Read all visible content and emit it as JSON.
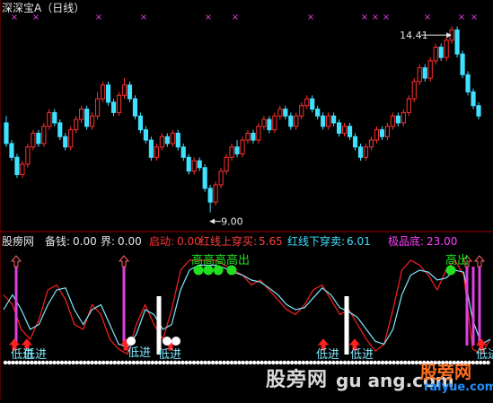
{
  "top_panel": {
    "title": "深深宝A（日线）",
    "high_label": "14.41",
    "low_label": "9.00"
  },
  "bottom_panel": {
    "name": "股痨网",
    "fields": [
      {
        "label": "备钱:",
        "value": "0.00",
        "color": "#e6e6e6"
      },
      {
        "label": "界:",
        "value": "0.00",
        "color": "#e6e6e6"
      },
      {
        "label": "启动:",
        "value": "0.00",
        "color": "#ff3030"
      },
      {
        "label": "红线上穿买:",
        "value": "5.65",
        "color": "#ff4040"
      },
      {
        "label": "红线下穿卖:",
        "value": "6.01",
        "color": "#40e0ff"
      },
      {
        "label": "极品底:",
        "value": "23.00",
        "color": "#ff40ff"
      }
    ],
    "signal_texts": {
      "high_out": "高出",
      "low_in": "低进",
      "high_out_stacked": "高高高高出"
    }
  },
  "watermarks": {
    "main": "股旁网",
    "url": "gu   ang.com",
    "logo_text": "股旁网",
    "logo_url": "ralyue.com"
  },
  "colors": {
    "up": "#ff3030",
    "down": "#40e0ff",
    "white_line": "#ffffff",
    "red_line": "#ff2020",
    "cyan_line": "#80e8ff",
    "magenta": "#e040e0",
    "green": "#20e020",
    "divider": "#a00000"
  },
  "chart_data": [
    {
      "type": "candlestick",
      "title": "深深宝A（日线）",
      "annotations": [
        {
          "text": "14.41",
          "meaning": "period high"
        },
        {
          "text": "9.00",
          "meaning": "period low"
        }
      ],
      "ylim": [
        8.6,
        14.7
      ],
      "candles": [
        [
          11.6,
          11.0,
          11.8,
          10.9
        ],
        [
          11.0,
          10.6,
          11.1,
          10.5
        ],
        [
          10.6,
          10.1,
          10.7,
          10.0
        ],
        [
          10.1,
          10.4,
          10.5,
          10.0
        ],
        [
          10.4,
          10.9,
          11.0,
          10.3
        ],
        [
          10.9,
          11.3,
          11.4,
          10.8
        ],
        [
          11.3,
          11.0,
          11.4,
          10.9
        ],
        [
          11.0,
          11.5,
          11.6,
          10.9
        ],
        [
          11.5,
          11.9,
          12.0,
          11.4
        ],
        [
          11.9,
          11.6,
          12.0,
          11.5
        ],
        [
          11.6,
          11.2,
          11.7,
          11.1
        ],
        [
          11.2,
          10.9,
          11.3,
          10.8
        ],
        [
          10.9,
          11.4,
          11.5,
          10.8
        ],
        [
          11.4,
          11.7,
          11.8,
          11.3
        ],
        [
          11.7,
          12.0,
          12.1,
          11.6
        ],
        [
          12.0,
          11.5,
          12.1,
          11.4
        ],
        [
          11.5,
          11.8,
          11.9,
          11.4
        ],
        [
          11.8,
          12.3,
          12.5,
          11.7
        ],
        [
          12.3,
          12.7,
          12.8,
          12.2
        ],
        [
          12.7,
          12.2,
          12.8,
          12.1
        ],
        [
          12.2,
          11.9,
          12.3,
          11.8
        ],
        [
          11.9,
          12.4,
          12.5,
          11.8
        ],
        [
          12.4,
          12.7,
          12.9,
          12.3
        ],
        [
          12.7,
          12.3,
          12.8,
          12.2
        ],
        [
          12.3,
          11.8,
          12.4,
          11.7
        ],
        [
          11.8,
          11.4,
          11.9,
          11.3
        ],
        [
          11.4,
          11.1,
          11.5,
          11.0
        ],
        [
          11.1,
          10.6,
          11.2,
          10.5
        ],
        [
          10.6,
          10.9,
          11.0,
          10.5
        ],
        [
          10.9,
          11.2,
          11.3,
          10.8
        ],
        [
          11.2,
          11.0,
          11.3,
          10.9
        ],
        [
          11.0,
          11.3,
          11.4,
          10.9
        ],
        [
          11.3,
          10.9,
          11.4,
          10.8
        ],
        [
          10.9,
          10.6,
          11.0,
          10.5
        ],
        [
          10.6,
          10.2,
          10.7,
          10.1
        ],
        [
          10.2,
          10.5,
          10.6,
          10.1
        ],
        [
          10.5,
          10.3,
          10.6,
          10.2
        ],
        [
          10.3,
          9.7,
          10.4,
          9.6
        ],
        [
          9.7,
          9.3,
          9.8,
          9.0
        ],
        [
          9.3,
          9.8,
          9.9,
          9.2
        ],
        [
          9.8,
          10.2,
          10.3,
          9.7
        ],
        [
          10.2,
          10.6,
          10.7,
          10.1
        ],
        [
          10.6,
          10.9,
          11.0,
          10.5
        ],
        [
          10.9,
          10.7,
          11.1,
          10.6
        ],
        [
          10.7,
          11.1,
          11.2,
          10.6
        ],
        [
          11.1,
          11.3,
          11.4,
          11.0
        ],
        [
          11.3,
          11.1,
          11.4,
          11.0
        ],
        [
          11.1,
          11.5,
          11.6,
          11.0
        ],
        [
          11.5,
          11.7,
          11.8,
          11.4
        ],
        [
          11.7,
          11.4,
          11.8,
          11.3
        ],
        [
          11.4,
          11.8,
          11.9,
          11.3
        ],
        [
          11.8,
          12.0,
          12.1,
          11.7
        ],
        [
          12.0,
          11.8,
          12.1,
          11.7
        ],
        [
          11.8,
          11.5,
          11.9,
          11.4
        ],
        [
          11.5,
          11.8,
          11.9,
          11.4
        ],
        [
          11.8,
          12.1,
          12.2,
          11.7
        ],
        [
          12.1,
          12.3,
          12.4,
          12.0
        ],
        [
          12.3,
          12.0,
          12.4,
          11.9
        ],
        [
          12.0,
          11.8,
          12.1,
          11.7
        ],
        [
          11.8,
          11.5,
          11.9,
          11.4
        ],
        [
          11.5,
          11.8,
          11.9,
          11.4
        ],
        [
          11.8,
          11.6,
          11.9,
          11.5
        ],
        [
          11.6,
          11.3,
          11.7,
          11.2
        ],
        [
          11.3,
          11.5,
          11.6,
          11.2
        ],
        [
          11.5,
          11.2,
          11.6,
          11.1
        ],
        [
          11.2,
          10.9,
          11.3,
          10.8
        ],
        [
          10.9,
          10.6,
          11.0,
          10.5
        ],
        [
          10.6,
          10.9,
          11.0,
          10.5
        ],
        [
          10.9,
          11.1,
          11.2,
          10.8
        ],
        [
          11.1,
          11.4,
          11.5,
          11.0
        ],
        [
          11.4,
          11.2,
          11.5,
          11.1
        ],
        [
          11.2,
          11.5,
          11.6,
          11.1
        ],
        [
          11.5,
          11.8,
          11.9,
          11.4
        ],
        [
          11.8,
          11.6,
          11.9,
          11.5
        ],
        [
          11.6,
          11.9,
          12.0,
          11.5
        ],
        [
          11.9,
          12.3,
          12.4,
          11.8
        ],
        [
          12.3,
          12.8,
          12.9,
          12.2
        ],
        [
          12.8,
          13.2,
          13.3,
          12.7
        ],
        [
          13.2,
          12.9,
          13.3,
          12.8
        ],
        [
          12.9,
          13.4,
          13.5,
          12.8
        ],
        [
          13.4,
          13.8,
          13.9,
          13.3
        ],
        [
          13.8,
          13.5,
          13.9,
          13.4
        ],
        [
          13.5,
          14.0,
          14.1,
          13.4
        ],
        [
          14.0,
          14.3,
          14.41,
          13.9
        ],
        [
          14.3,
          13.6,
          14.4,
          13.5
        ],
        [
          13.6,
          13.0,
          13.7,
          12.9
        ],
        [
          13.0,
          12.5,
          13.1,
          12.4
        ],
        [
          12.5,
          12.1,
          12.6,
          12.0
        ],
        [
          12.1,
          11.8,
          12.2,
          11.7
        ]
      ]
    },
    {
      "type": "line",
      "series": [
        {
          "name": "",
          "color": "red",
          "values": [
            0.65,
            0.55,
            0.3,
            0.2,
            0.4,
            0.7,
            0.75,
            0.6,
            0.35,
            0.3,
            0.55,
            0.45,
            0.2,
            0.1,
            0.05,
            0.35,
            0.55,
            0.35,
            0.2,
            0.5,
            0.9,
            1.0,
            1.0,
            1.0,
            1.0,
            0.95,
            0.9,
            0.85,
            0.75,
            0.8,
            0.7,
            0.6,
            0.5,
            0.45,
            0.55,
            0.7,
            0.75,
            0.6,
            0.45,
            0.5,
            0.35,
            0.2,
            0.08,
            0.15,
            0.5,
            0.9,
            1.0,
            0.95,
            0.85,
            0.7,
            0.9,
            1.0,
            0.85,
            0.1,
            0.05,
            0.2
          ]
        },
        {
          "name": "",
          "color": "cyan",
          "values": [
            0.5,
            0.65,
            0.5,
            0.3,
            0.35,
            0.55,
            0.7,
            0.72,
            0.5,
            0.35,
            0.5,
            0.55,
            0.35,
            0.15,
            0.12,
            0.25,
            0.5,
            0.45,
            0.3,
            0.35,
            0.7,
            0.9,
            0.95,
            0.95,
            0.95,
            0.92,
            0.88,
            0.85,
            0.8,
            0.78,
            0.72,
            0.65,
            0.55,
            0.5,
            0.52,
            0.62,
            0.72,
            0.65,
            0.52,
            0.48,
            0.42,
            0.3,
            0.18,
            0.15,
            0.3,
            0.65,
            0.85,
            0.9,
            0.88,
            0.8,
            0.82,
            0.9,
            0.88,
            0.4,
            0.15,
            0.2
          ]
        }
      ]
    }
  ]
}
